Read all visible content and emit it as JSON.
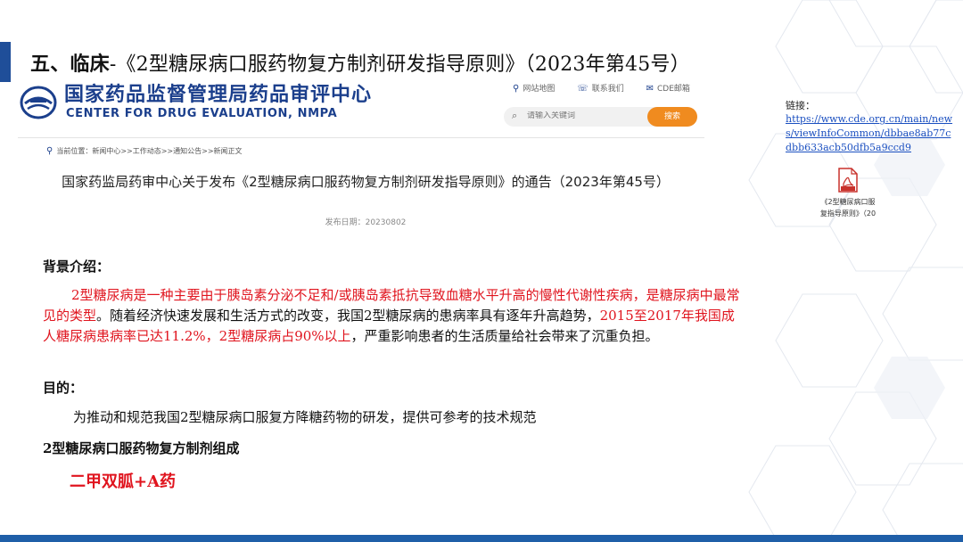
{
  "slide": {
    "title_bold": "五、临床",
    "title_rest": "-《2型糖尿病口服药物复方制剂研发指导原则》（2023年第45号）"
  },
  "site": {
    "org_cn": "国家药品监督管理局药品审评中心",
    "org_en": "CENTER FOR DRUG EVALUATION, NMPA",
    "links": [
      "网站地图",
      "联系我们",
      "CDE邮箱"
    ],
    "search_placeholder": "请输入关键词",
    "search_button": "搜索",
    "breadcrumb": "当前位置：新闻中心>>工作动态>>通知公告>>新闻正文",
    "notice_title": "国家药监局药审中心关于发布《2型糖尿病口服药物复方制剂研发指导原则》的通告（2023年第45号）",
    "pub_date": "发布日期：20230802"
  },
  "link_block": {
    "label": "链接：",
    "url": "https://www.cde.org.cn/main/news/viewInfoCommon/dbbae8ab77cdbb633acb50dfb5a9ccd9",
    "pdf_caption_1": "《2型糖尿病口服",
    "pdf_caption_2": "复指导原则》（20"
  },
  "background": {
    "heading": "背景介绍：",
    "p_red_1": "2型糖尿病是一种主要由于胰岛素分泌不足和/或胰岛素抵抗导致血糖水平升高的慢性代谢性疾病，是糖尿病中最常见的类型",
    "p_black_1": "。随着经济快速发展和生活方式的改变，我国2型糖尿病的患病率具有逐年升高趋势，",
    "p_red_2": "2015至2017年我国成人糖尿病患病率已达11.2%，2型糖尿病占90%以上",
    "p_black_2": "，严重影响患者的生活质量给社会带来了沉重负担。"
  },
  "purpose": {
    "heading": "目的：",
    "text": "为推动和规范我国2型糖尿病口服复方降糖药物的研发，提供可参考的技术规范"
  },
  "composition": {
    "heading": "2型糖尿病口服药物复方制剂组成",
    "formula": "二甲双胍+A药"
  },
  "colors": {
    "accent_blue": "#1f4e99",
    "highlight_red": "#e0141e",
    "search_orange": "#f08b1f"
  },
  "icons": [
    "cde-logo-icon",
    "location-pin-icon",
    "phone-icon",
    "mail-icon",
    "search-icon",
    "pdf-icon"
  ]
}
